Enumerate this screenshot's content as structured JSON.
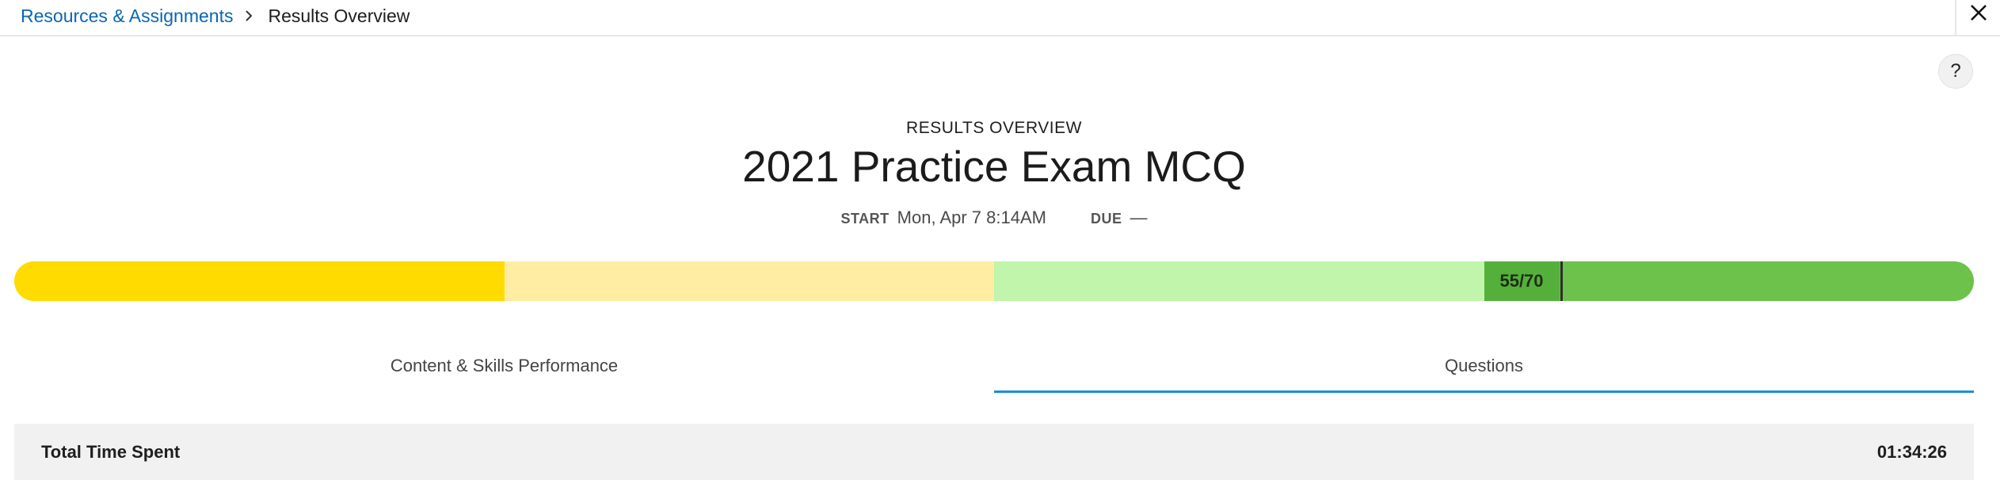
{
  "breadcrumb": {
    "parent": "Resources & Assignments",
    "separator_icon": "chevron-right-icon",
    "current": "Results Overview"
  },
  "header": {
    "close_icon": "close-icon",
    "help_label": "?"
  },
  "assignment": {
    "kicker": "RESULTS OVERVIEW",
    "title": "2021 Practice Exam MCQ",
    "start_label": "START",
    "start_value": "Mon, Apr 7 8:14AM",
    "due_label": "DUE",
    "due_value": "—"
  },
  "score": {
    "label": "55/70",
    "earned": 55,
    "possible": 70,
    "band_colors": [
      "#ffdb00",
      "#feeda3",
      "#c0f5ab",
      "#6cc24a"
    ]
  },
  "tabs": [
    {
      "label": "Content & Skills Performance",
      "active": false
    },
    {
      "label": "Questions",
      "active": true
    }
  ],
  "summary": {
    "label": "Total Time Spent",
    "value": "01:34:26"
  },
  "colors": {
    "link": "#0a66b3",
    "tab_active_underline": "#1a8fd9"
  }
}
